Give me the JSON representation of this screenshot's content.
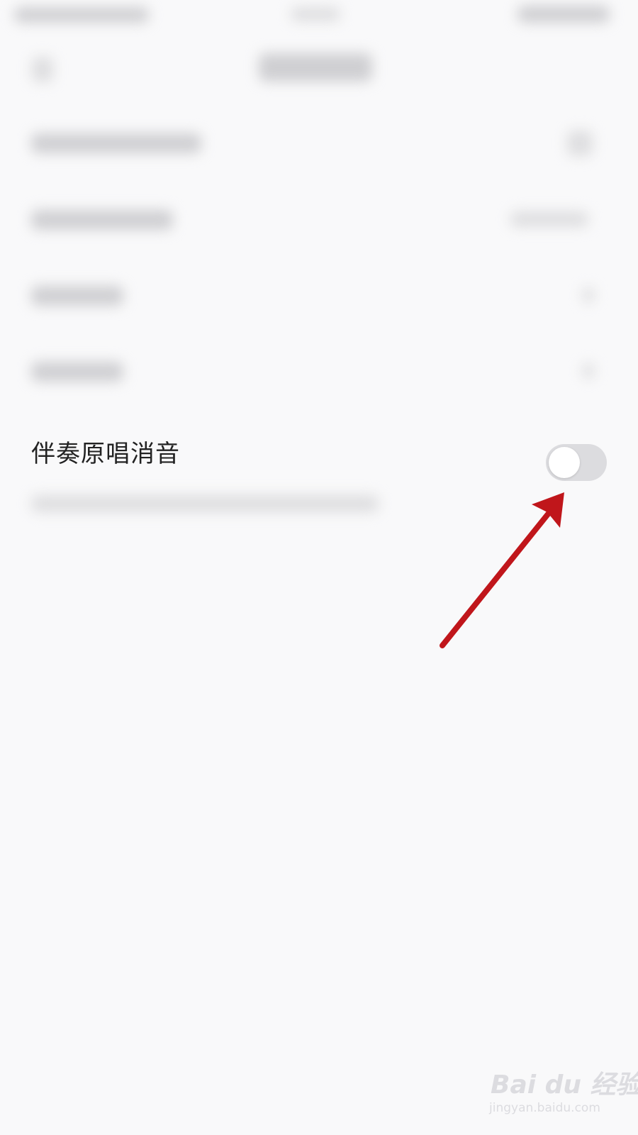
{
  "setting": {
    "label": "伴奏原唱消音",
    "enabled": false
  },
  "watermark": {
    "logo": "Bai du 经验",
    "url": "jingyan.baidu.com"
  },
  "colors": {
    "background": "#f9f9fa",
    "toggle_off_track": "#dcdcdf",
    "annotation_arrow": "#c0161b"
  },
  "icons": {
    "back": "back-arrow-icon",
    "annotation": "annotation-arrow-icon"
  }
}
